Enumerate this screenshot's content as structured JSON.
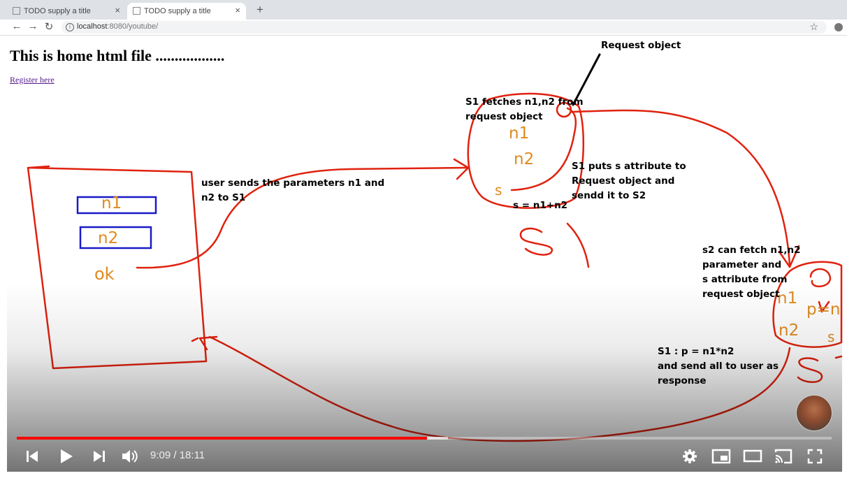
{
  "browser": {
    "tabs": [
      {
        "title": "TODO supply a title",
        "close": "×"
      },
      {
        "title": "TODO supply a title",
        "close": "×"
      }
    ],
    "new_tab": "+",
    "nav": {
      "back": "←",
      "forward": "→",
      "reload": "↻"
    },
    "url_host": "localhost",
    "url_rest": ":8080/youtube/",
    "bookmark": "☆"
  },
  "page": {
    "heading": "This is home html file ..................",
    "register_link": "Register here"
  },
  "whiteboard": {
    "form_fields": [
      "n1",
      "n2"
    ],
    "ok": "ok",
    "note_user_sends": [
      "user sends the parameters n1 and",
      "n2 to S1"
    ],
    "note_request_object": "Request object",
    "note_s1_fetches": [
      "S1 fetches n1,n2 from",
      "request object"
    ],
    "s1_vars": {
      "n1": "n1",
      "n2": "n2",
      "s": "s"
    },
    "s1_formula": "s = n1+n2",
    "note_s1_puts": [
      "S1 puts s attribute to",
      "Request object and",
      "sendd it to S2"
    ],
    "note_s2_fetch": [
      "s2 can fetch n1,n2",
      "parameter and",
      "s attribute from",
      "request object"
    ],
    "s2_vars": {
      "n1": "n1",
      "n2": "n2",
      "p": "p=n",
      "s": "s"
    },
    "note_response": [
      "S1 : p = n1*n2",
      "and send all to user as",
      "response"
    ]
  },
  "player": {
    "time_current": "9:09",
    "time_total": "18:11",
    "progress": 0.5035,
    "buffered": 0.529,
    "colors": {
      "played": "#ff0000",
      "ink_red": "#e0220f",
      "ink_blue": "#1a1ac8",
      "ink_orange": "#e08a1e"
    }
  }
}
